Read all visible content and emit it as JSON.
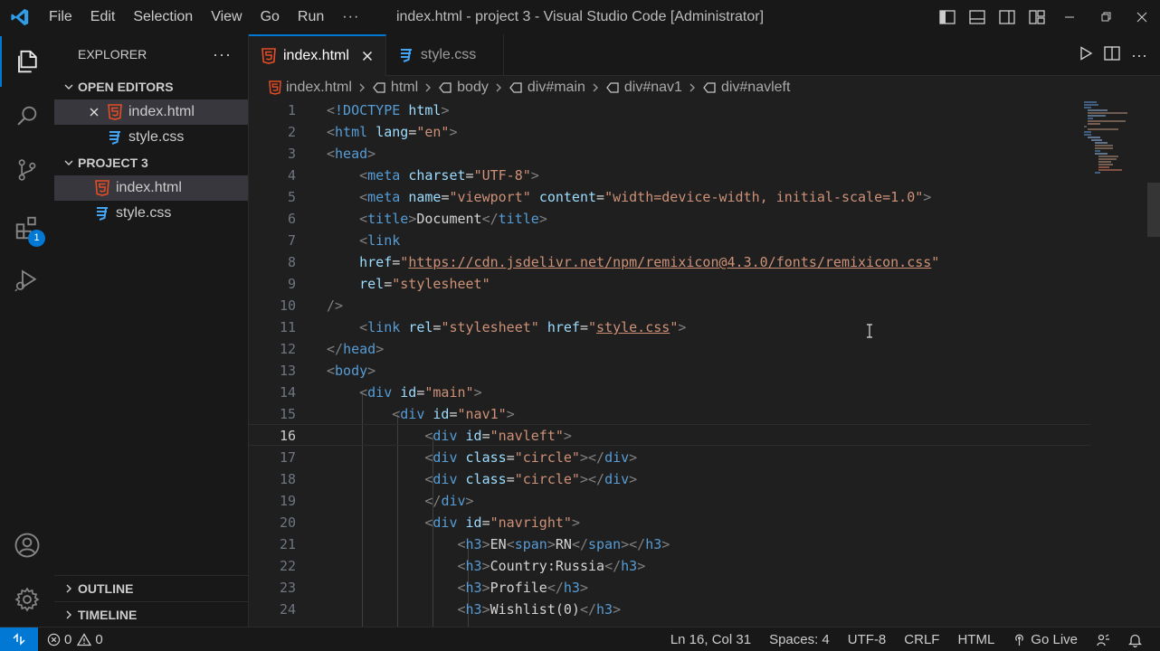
{
  "titlebar": {
    "menu": [
      "File",
      "Edit",
      "Selection",
      "View",
      "Go",
      "Run",
      "···"
    ],
    "title": "index.html - project 3 - Visual Studio Code [Administrator]"
  },
  "activitybar": {
    "items": [
      "explorer-icon",
      "search-icon",
      "source-control-icon",
      "extensions-icon",
      "run-debug-icon"
    ],
    "extensions_badge": "1",
    "bottom": [
      "accounts-icon",
      "settings-gear-icon"
    ]
  },
  "sidebar": {
    "title": "EXPLORER",
    "more": "···",
    "open_editors": {
      "label": "OPEN EDITORS",
      "files": [
        "index.html",
        "style.css"
      ]
    },
    "project": {
      "label": "PROJECT 3",
      "files": [
        "index.html",
        "style.css"
      ]
    },
    "outline": "OUTLINE",
    "timeline": "TIMELINE"
  },
  "tabs": [
    {
      "label": "index.html",
      "active": true
    },
    {
      "label": "style.css",
      "active": false
    }
  ],
  "breadcrumb": [
    "index.html",
    "html",
    "body",
    "div#main",
    "div#nav1",
    "div#navleft"
  ],
  "editor": {
    "current_line": 16,
    "lines": [
      {
        "n": "1"
      },
      {
        "n": "2"
      },
      {
        "n": "3"
      },
      {
        "n": "4"
      },
      {
        "n": "5"
      },
      {
        "n": "6"
      },
      {
        "n": "7"
      },
      {
        "n": "8"
      },
      {
        "n": "9"
      },
      {
        "n": "10"
      },
      {
        "n": "11"
      },
      {
        "n": "12"
      },
      {
        "n": "13"
      },
      {
        "n": "14"
      },
      {
        "n": "15"
      },
      {
        "n": "16"
      },
      {
        "n": "17"
      },
      {
        "n": "18"
      },
      {
        "n": "19"
      },
      {
        "n": "20"
      },
      {
        "n": "21"
      },
      {
        "n": "22"
      },
      {
        "n": "23"
      },
      {
        "n": "24"
      }
    ],
    "code": {
      "l1_tag": "!DOCTYPE",
      "l1_html": "html",
      "l2_tag": "html",
      "l2_attr": "lang",
      "l2_val": "\"en\"",
      "l3_tag": "head",
      "l4_tag": "meta",
      "l4_attr": "charset",
      "l4_val": "\"UTF-8\"",
      "l5_tag": "meta",
      "l5_a1": "name",
      "l5_v1": "\"viewport\"",
      "l5_a2": "content",
      "l5_v2": "\"width=device-width, initial-scale=1.0\"",
      "l6_tag": "title",
      "l6_text": "Document",
      "l7_tag": "link",
      "l8_attr": "href",
      "l8_q1": "\"",
      "l8_url": "https://cdn.jsdelivr.net/npm/remixicon@4.3.0/fonts/remixicon.css",
      "l8_q2": "\"",
      "l9_attr": "rel",
      "l9_val": "\"stylesheet\"",
      "l10_text": "/>",
      "l11_tag": "link",
      "l11_a1": "rel",
      "l11_v1": "\"stylesheet\"",
      "l11_a2": "href",
      "l11_q1": "\"",
      "l11_url": "style.css",
      "l11_q2": "\"",
      "l12_tag": "head",
      "l13_tag": "body",
      "l14_tag": "div",
      "l14_attr": "id",
      "l14_val": "\"main\"",
      "l15_tag": "div",
      "l15_attr": "id",
      "l15_val": "\"nav1\"",
      "l16_tag": "div",
      "l16_attr": "id",
      "l16_val": "\"navleft\"",
      "l17_tag": "div",
      "l17_attr": "class",
      "l17_val": "\"circle\"",
      "l18_tag": "div",
      "l18_attr": "class",
      "l18_val": "\"circle\"",
      "l19_tag": "div",
      "l20_tag": "div",
      "l20_attr": "id",
      "l20_val": "\"navright\"",
      "l21_tag": "h3",
      "l21_t1": "EN",
      "l21_span": "span",
      "l21_t2": "RN",
      "l22_tag": "h3",
      "l22_text": "Country:Russia",
      "l23_tag": "h3",
      "l23_text": "Profile",
      "l24_tag": "h3",
      "l24_text": "Wishlist(0)"
    }
  },
  "statusbar": {
    "errors": "0",
    "warnings": "0",
    "position": "Ln 16, Col 31",
    "spaces": "Spaces: 4",
    "encoding": "UTF-8",
    "eol": "CRLF",
    "language": "HTML",
    "golive": "Go Live"
  },
  "colors": {
    "accent": "#0078d4",
    "html_icon": "#e44d26",
    "css_icon": "#42a5f5",
    "tag": "#569cd6",
    "attr": "#9cdcfe",
    "string": "#ce9178"
  }
}
